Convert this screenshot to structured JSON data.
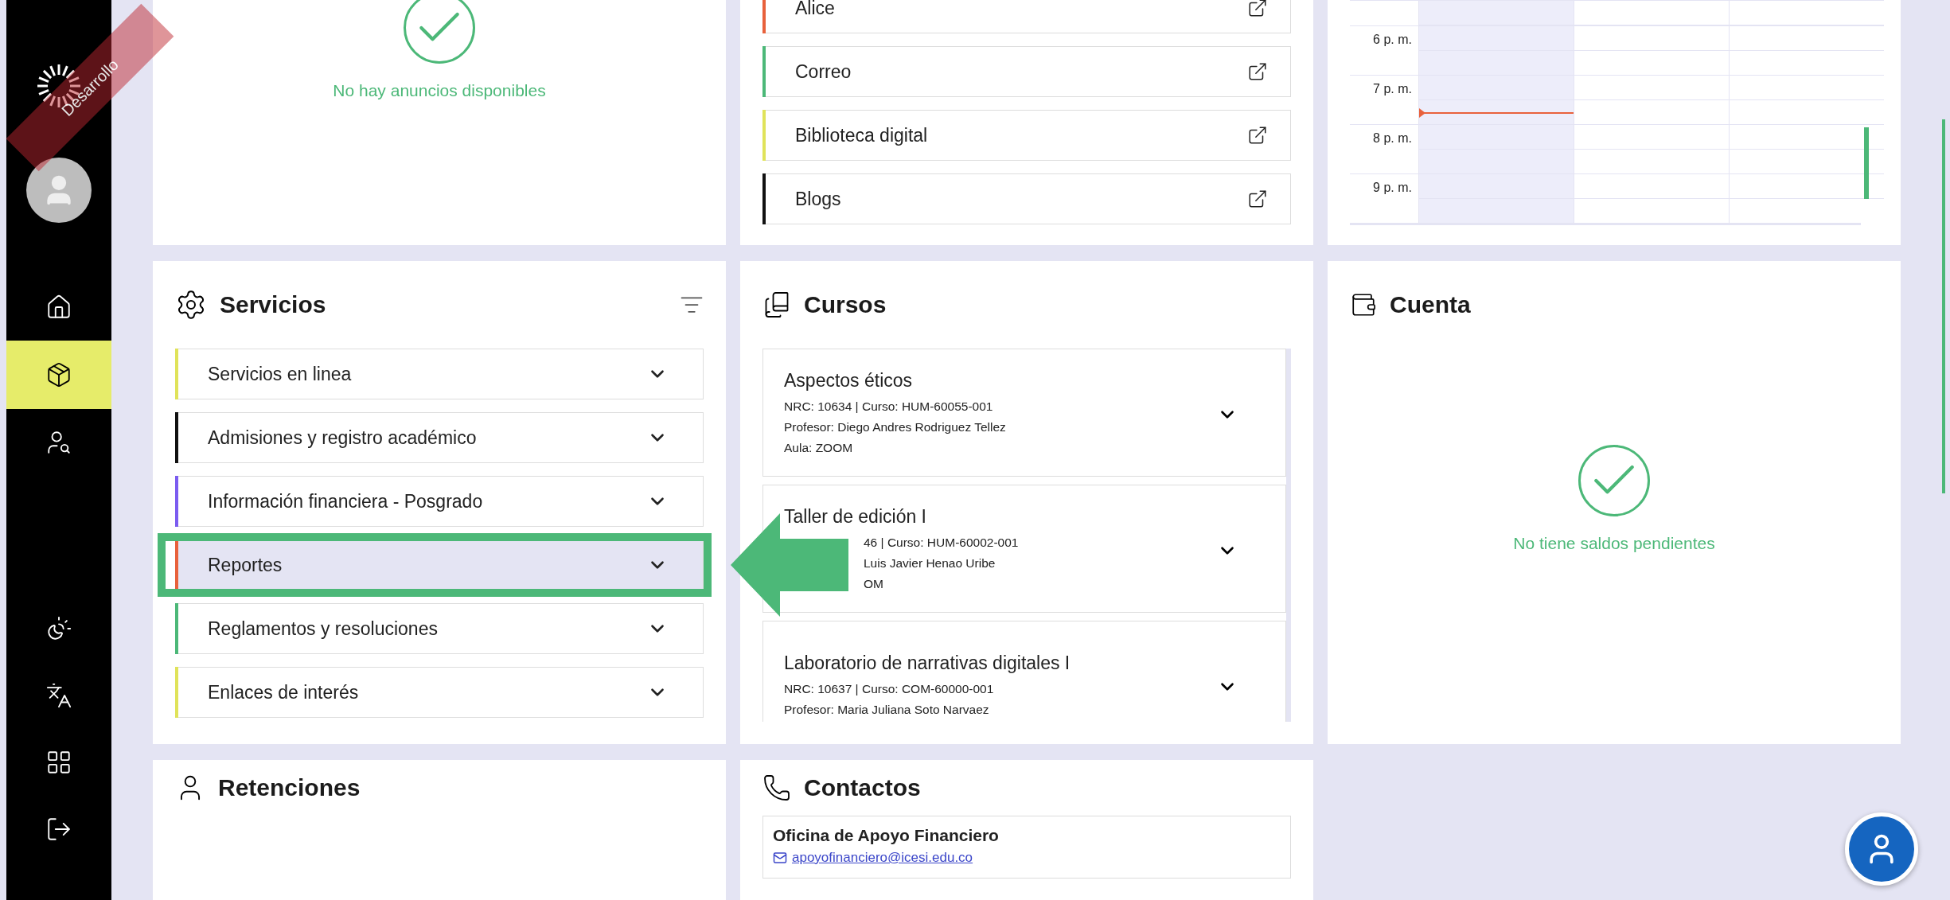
{
  "sidebar": {
    "banner": "Desarrollo",
    "items": [
      {
        "selected": false
      },
      {
        "selected": true
      },
      {
        "selected": false
      }
    ]
  },
  "announcements": {
    "message": "No hay anuncios disponibles"
  },
  "links": [
    {
      "label": "Alice",
      "color": "#e8613c"
    },
    {
      "label": "Correo",
      "color": "#4cb878"
    },
    {
      "label": "Biblioteca digital",
      "color": "#e0e35a"
    },
    {
      "label": "Blogs",
      "color": "#111111"
    }
  ],
  "calendar": {
    "times": [
      "6 p. m.",
      "7 p. m.",
      "8 p. m.",
      "9 p. m."
    ]
  },
  "services": {
    "title": "Servicios",
    "items": [
      {
        "label": "Servicios en linea",
        "color": "#e0e35a",
        "selected": false
      },
      {
        "label": "Admisiones y registro académico",
        "color": "#111111",
        "selected": false
      },
      {
        "label": "Información financiera - Posgrado",
        "color": "#7b5cf0",
        "selected": false
      },
      {
        "label": "Reportes",
        "color": "#e8613c",
        "selected": true
      },
      {
        "label": "Reglamentos y resoluciones",
        "color": "#4cb878",
        "selected": false
      },
      {
        "label": "Enlaces de interés",
        "color": "#e0e35a",
        "selected": false
      }
    ]
  },
  "courses": {
    "title": "Cursos",
    "items": [
      {
        "title": "Aspectos éticos",
        "lines": [
          "NRC: 10634 | Curso: HUM-60055-001",
          "Profesor: Diego Andres Rodriguez Tellez",
          "Aula: ZOOM"
        ]
      },
      {
        "title": "Taller de edición I",
        "lines": [
          "46 | Curso: HUM-60002-001",
          "Luis Javier Henao Uribe",
          "OM"
        ]
      },
      {
        "title": "Laboratorio de narrativas digitales I",
        "lines": [
          "NRC: 10637 | Curso: COM-60000-001",
          "Profesor: Maria Juliana Soto Narvaez"
        ]
      }
    ]
  },
  "account": {
    "title": "Cuenta",
    "message": "No tiene saldos pendientes"
  },
  "retentions": {
    "title": "Retenciones"
  },
  "contacts": {
    "title": "Contactos",
    "items": [
      {
        "name": "Oficina de Apoyo Financiero",
        "email": "apoyofinanciero@icesi.edu.co"
      }
    ]
  }
}
